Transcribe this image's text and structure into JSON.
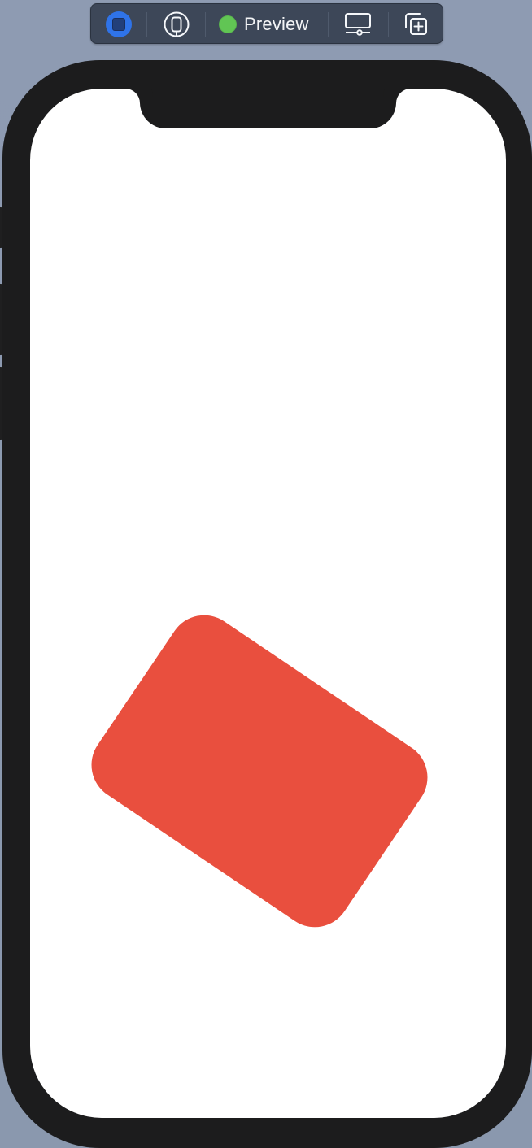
{
  "toolbar": {
    "preview_label": "Preview",
    "icons": {
      "live": "live-preview-icon",
      "device": "device-icon",
      "preview_status": "preview-status-dot-icon",
      "display": "device-display-icon",
      "duplicate": "duplicate-icon"
    },
    "colors": {
      "toolbar_bg": "#3d4758",
      "live_blue": "#2f73e8",
      "preview_green": "#61c554",
      "icon_white": "#f4f6f9"
    }
  },
  "canvas": {
    "background": "#8d9bb1",
    "phone_frame": "#1c1c1d",
    "screen": "#ffffff",
    "card_color": "#e94f3e",
    "card_rotation_degrees": 34
  }
}
